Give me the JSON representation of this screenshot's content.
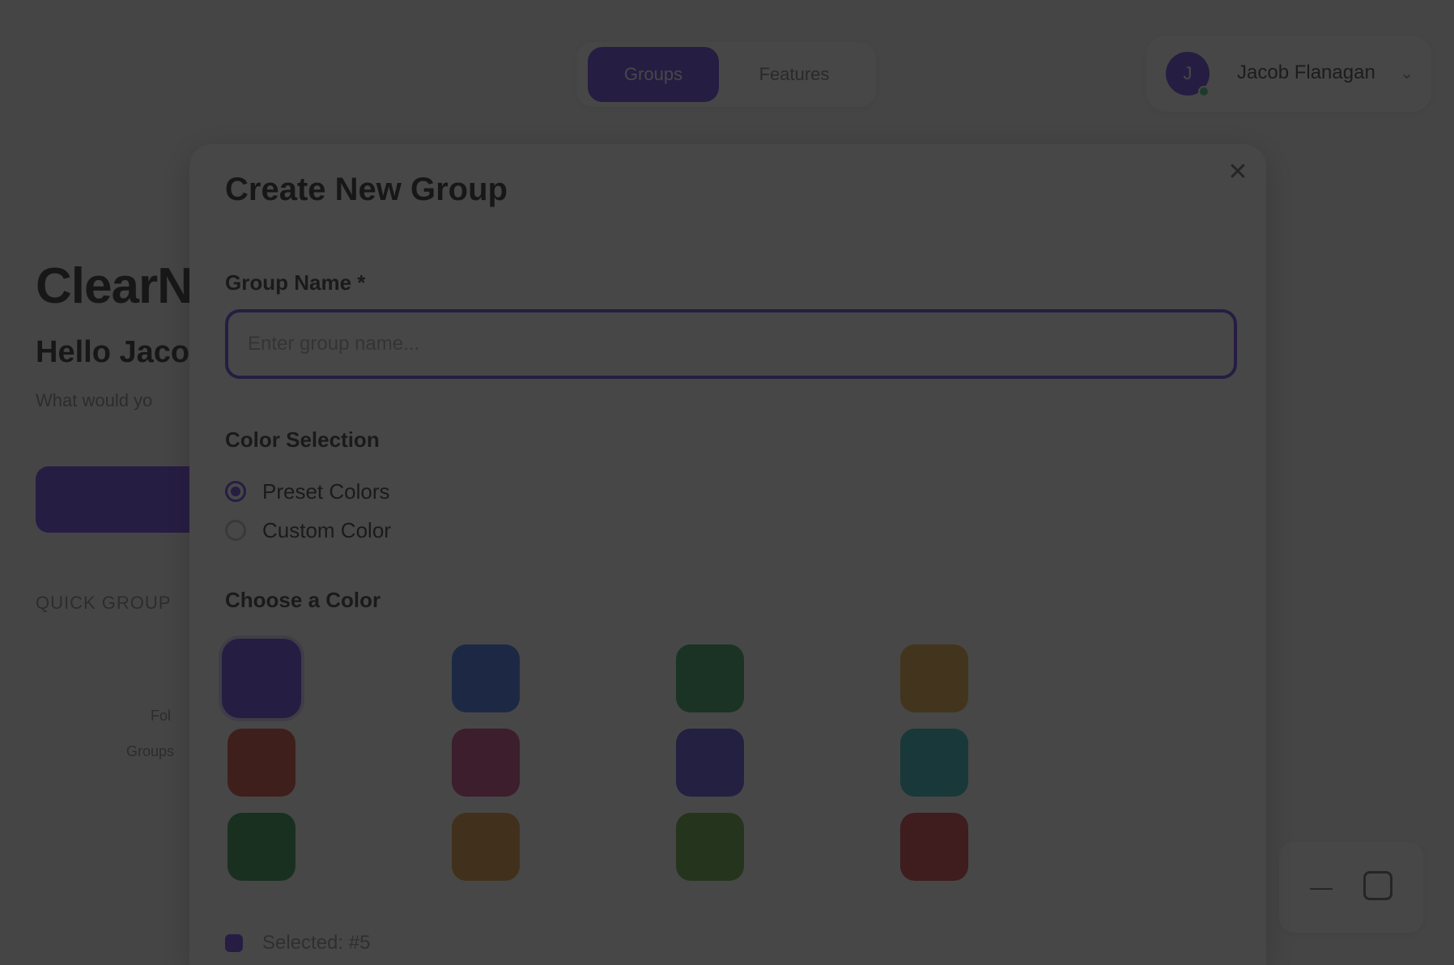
{
  "nav": {
    "tabs": [
      {
        "label": "Groups",
        "active": true
      },
      {
        "label": "Features",
        "active": false
      }
    ]
  },
  "user": {
    "initial": "J",
    "name": "Jacob Flanagan"
  },
  "background": {
    "brand": "ClearN",
    "greeting": "Hello Jaco",
    "subtitle": "What would yo",
    "section_heading": "QUICK GROUP",
    "small_label_1": "Fol",
    "small_label_2": "Groups"
  },
  "modal": {
    "title": "Create New Group",
    "close_icon": "✕",
    "group_name_label": "Group Name *",
    "group_name_placeholder": "Enter group name...",
    "color_selection_label": "Color Selection",
    "color_options": [
      {
        "label": "Preset Colors",
        "checked": true
      },
      {
        "label": "Custom Color",
        "checked": false
      }
    ],
    "choose_color_label": "Choose a Color",
    "preset_colors": [
      "#5b2ee8",
      "#2f6bf1",
      "#1f9d55",
      "#e8a530",
      "#d83a2a",
      "#c9327d",
      "#4a3fe0",
      "#1bb3b8",
      "#1a8a43",
      "#e0932a",
      "#58a52e",
      "#d82a35"
    ],
    "selected_color_index": 0,
    "preview_text": "Selected: #5"
  },
  "colors": {
    "accent": "#5b2ee8",
    "overlay": "rgba(25,25,25,0.8)"
  }
}
